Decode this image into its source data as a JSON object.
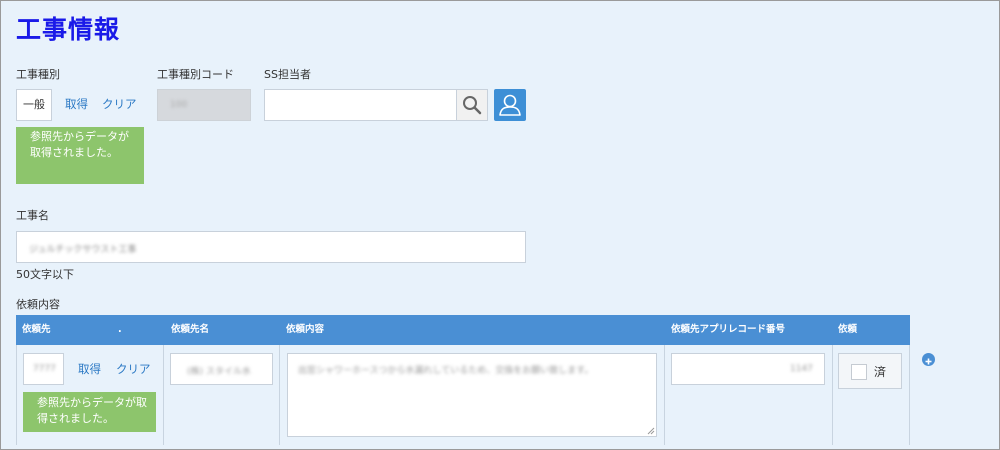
{
  "page": {
    "title": "工事情報"
  },
  "construction_type": {
    "label": "工事種別",
    "value": "一般",
    "get_label": "取得",
    "clear_label": "クリア",
    "message": "参照先からデータが取得されました。"
  },
  "construction_type_code": {
    "label": "工事種別コード",
    "value": "100"
  },
  "ss_person": {
    "label": "SS担当者",
    "value": ""
  },
  "construction_name": {
    "label": "工事名",
    "value": "ジュルチックサウスト工事",
    "hint": "50文字以下"
  },
  "request": {
    "label": "依頼内容",
    "headers": {
      "requester": "依頼先",
      "dot": ".",
      "requester_name": "依頼先名",
      "content": "依頼内容",
      "app_code": "依頼先アプリレコード番号",
      "request": "依頼"
    },
    "row": {
      "requester_value": "7777",
      "get_label": "取得",
      "clear_label": "クリア",
      "message": "参照先からデータが取得されました。",
      "requester_name": "(株) スタイル水",
      "content": "出窓シャワーホースつから水漏れしているため、交換をお願い致します。",
      "app_code": "1147",
      "done_label": "済"
    }
  },
  "colors": {
    "title": "#1a1ae8",
    "link": "#2a78c4",
    "header": "#4a8fd4",
    "success": "#8dc56c"
  }
}
